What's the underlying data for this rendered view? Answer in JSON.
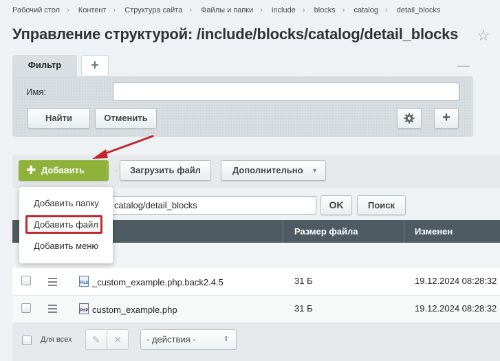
{
  "breadcrumb": [
    "Рабочий стол",
    "Контент",
    "Структура сайта",
    "Файлы и папки",
    "include",
    "blocks",
    "catalog",
    "detail_blocks"
  ],
  "page_title": "Управление структурой: /include/blocks/catalog/detail_blocks",
  "filter": {
    "tab_label": "Фильтр",
    "name_label": "Имя:",
    "name_value": "",
    "find_label": "Найти",
    "cancel_label": "Отменить"
  },
  "toolbar": {
    "add_label": "Добавить",
    "upload_label": "Загрузить файл",
    "more_label": "Дополнительно"
  },
  "add_menu": {
    "items": [
      "Добавить папку",
      "Добавить файл",
      "Добавить меню"
    ],
    "highlighted": "Добавить файл"
  },
  "path_bar": {
    "value": "catalog/detail_blocks",
    "ok_label": "OK",
    "search_label": "Поиск"
  },
  "table": {
    "columns": [
      "Размер файла",
      "Изменен"
    ],
    "rows": [
      {
        "name": "_custom_example.php.back2.4.5",
        "icon": "file-icon",
        "size": "31 Б",
        "modified": "19.12.2024 08:28:32"
      },
      {
        "name": "custom_example.php",
        "icon": "php-file-icon",
        "size": "31 Б",
        "modified": "19.12.2024 08:28:32"
      }
    ]
  },
  "footer": {
    "select_all_label": "Для всех",
    "actions_value": "- действия -"
  },
  "colors": {
    "accent_green": "#8fb23a",
    "highlight_red": "#c2272d",
    "table_header": "#4f5b62"
  }
}
